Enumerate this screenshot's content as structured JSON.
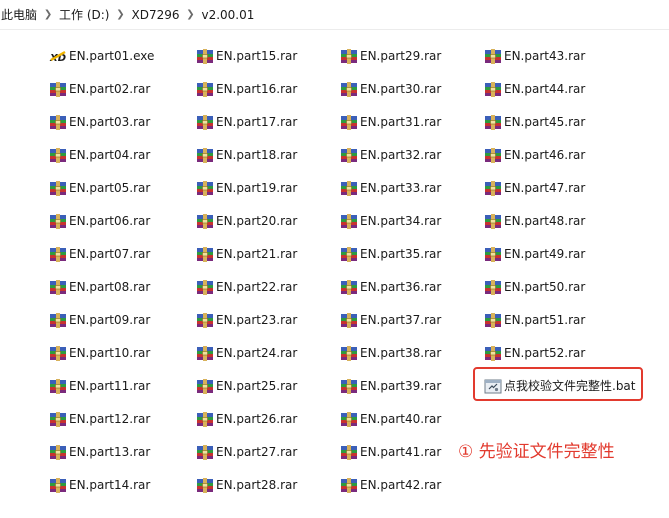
{
  "breadcrumb": {
    "items": [
      "此电脑",
      "工作 (D:)",
      "XD7296",
      "v2.00.01"
    ],
    "separator_icon": "chevron-right-icon"
  },
  "files": {
    "col1": [
      "EN.part01.exe",
      "EN.part02.rar",
      "EN.part03.rar",
      "EN.part04.rar",
      "EN.part05.rar",
      "EN.part06.rar",
      "EN.part07.rar",
      "EN.part08.rar",
      "EN.part09.rar",
      "EN.part10.rar",
      "EN.part11.rar",
      "EN.part12.rar",
      "EN.part13.rar",
      "EN.part14.rar"
    ],
    "col2": [
      "EN.part15.rar",
      "EN.part16.rar",
      "EN.part17.rar",
      "EN.part18.rar",
      "EN.part19.rar",
      "EN.part20.rar",
      "EN.part21.rar",
      "EN.part22.rar",
      "EN.part23.rar",
      "EN.part24.rar",
      "EN.part25.rar",
      "EN.part26.rar",
      "EN.part27.rar",
      "EN.part28.rar"
    ],
    "col3": [
      "EN.part29.rar",
      "EN.part30.rar",
      "EN.part31.rar",
      "EN.part32.rar",
      "EN.part33.rar",
      "EN.part34.rar",
      "EN.part35.rar",
      "EN.part36.rar",
      "EN.part37.rar",
      "EN.part38.rar",
      "EN.part39.rar",
      "EN.part40.rar",
      "EN.part41.rar",
      "EN.part42.rar"
    ],
    "col4": [
      "EN.part43.rar",
      "EN.part44.rar",
      "EN.part45.rar",
      "EN.part46.rar",
      "EN.part47.rar",
      "EN.part48.rar",
      "EN.part49.rar",
      "EN.part50.rar",
      "EN.part51.rar",
      "EN.part52.rar"
    ],
    "bat_file": "点我校验文件完整性.bat"
  },
  "icons": {
    "exe": "winrar-sfx-icon",
    "rar": "winrar-archive-icon",
    "bat": "batch-file-icon"
  },
  "annotation": {
    "text": "① 先验证文件完整性"
  },
  "colors": {
    "annotation": "#e23a2e",
    "highlight_border": "#e23a2e"
  }
}
